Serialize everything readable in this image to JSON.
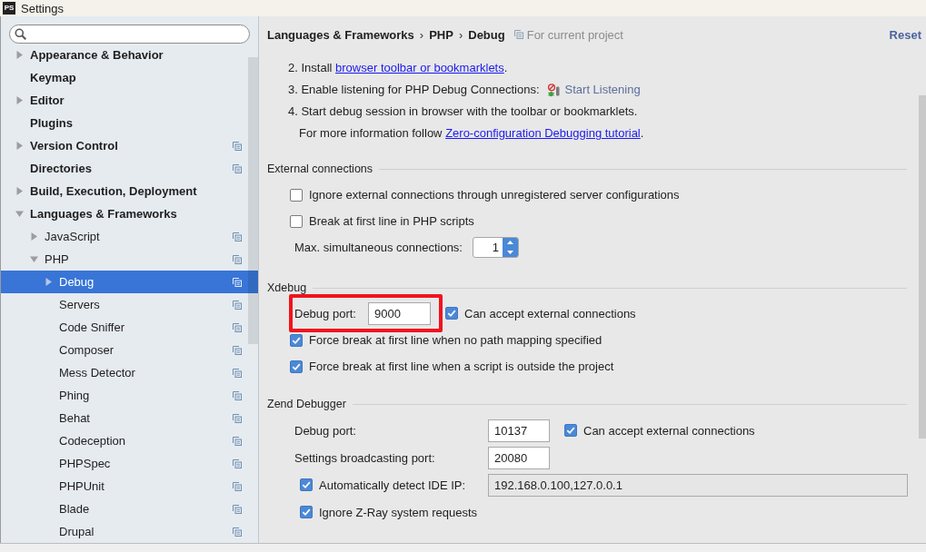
{
  "window": {
    "icon_text": "PS",
    "title": "Settings"
  },
  "sidebar": {
    "items": [
      {
        "label": "Appearance & Behavior",
        "expanded": false,
        "selected": false,
        "project_level": false
      },
      {
        "label": "Keymap",
        "selected": false,
        "project_level": false
      },
      {
        "label": "Editor",
        "expanded": false,
        "selected": false,
        "project_level": false
      },
      {
        "label": "Plugins",
        "selected": false,
        "project_level": false
      },
      {
        "label": "Version Control",
        "expanded": false,
        "selected": false,
        "project_level": true
      },
      {
        "label": "Directories",
        "selected": false,
        "project_level": true
      },
      {
        "label": "Build, Execution, Deployment",
        "expanded": false,
        "selected": false,
        "project_level": false
      },
      {
        "label": "Languages & Frameworks",
        "expanded": true,
        "selected": false,
        "project_level": false,
        "children": [
          {
            "label": "JavaScript",
            "expanded": false,
            "selected": false,
            "project_level": true
          },
          {
            "label": "PHP",
            "expanded": true,
            "selected": false,
            "project_level": true,
            "children": [
              {
                "label": "Debug",
                "expanded": false,
                "selected": true,
                "project_level": true
              },
              {
                "label": "Servers",
                "selected": false,
                "project_level": true
              },
              {
                "label": "Code Sniffer",
                "selected": false,
                "project_level": true
              },
              {
                "label": "Composer",
                "selected": false,
                "project_level": true
              },
              {
                "label": "Mess Detector",
                "selected": false,
                "project_level": true
              },
              {
                "label": "Phing",
                "selected": false,
                "project_level": true
              },
              {
                "label": "Behat",
                "selected": false,
                "project_level": true
              },
              {
                "label": "Codeception",
                "selected": false,
                "project_level": true
              },
              {
                "label": "PHPSpec",
                "selected": false,
                "project_level": true
              },
              {
                "label": "PHPUnit",
                "selected": false,
                "project_level": true
              },
              {
                "label": "Blade",
                "selected": false,
                "project_level": true
              },
              {
                "label": "Drupal",
                "selected": false,
                "project_level": true
              }
            ]
          }
        ]
      }
    ]
  },
  "header": {
    "breadcrumb": [
      {
        "kind": "crumb",
        "text": "Languages & Frameworks"
      },
      {
        "kind": "separator",
        "text": "›"
      },
      {
        "kind": "crumb",
        "text": "PHP"
      },
      {
        "kind": "separator",
        "text": "›"
      },
      {
        "kind": "crumb",
        "text": "Debug"
      }
    ],
    "scope": "For current project",
    "reset": "Reset"
  },
  "instructions": {
    "steps": [
      {
        "parts": [
          {
            "kind": "text",
            "text": "2. Install "
          },
          {
            "kind": "link",
            "text": "browser toolbar or bookmarklets"
          },
          {
            "kind": "text",
            "text": "."
          }
        ]
      },
      {
        "parts": [
          {
            "kind": "text",
            "text": "3. Enable listening for PHP Debug Connections:"
          },
          {
            "kind": "action",
            "text": "Start Listening"
          }
        ]
      },
      {
        "parts": [
          {
            "kind": "text",
            "text": "4. Start debug session in browser with the toolbar or bookmarklets."
          }
        ]
      }
    ],
    "note": {
      "parts": [
        {
          "kind": "text",
          "text": "For more information follow "
        },
        {
          "kind": "link",
          "text": "Zero-configuration Debugging tutorial"
        },
        {
          "kind": "text",
          "text": "."
        }
      ]
    }
  },
  "external_connections": {
    "title": "External connections",
    "options": [
      {
        "kind": "checkbox",
        "label": "Ignore external connections through unregistered server configurations",
        "checked": false
      },
      {
        "kind": "checkbox",
        "label": "Break at first line in PHP scripts",
        "checked": false
      },
      {
        "kind": "spinner",
        "label": "Max. simultaneous connections:",
        "value": "1"
      }
    ]
  },
  "xdebug": {
    "title": "Xdebug",
    "debug_port": {
      "label": "Debug port:",
      "value": "9000",
      "highlighted": true
    },
    "accept_external": {
      "label": "Can accept external connections",
      "checked": true
    },
    "options": [
      {
        "label": "Force break at first line when no path mapping specified",
        "checked": true
      },
      {
        "label": "Force break at first line when a script is outside the project",
        "checked": true
      }
    ]
  },
  "zend_debugger": {
    "title": "Zend Debugger",
    "debug_port": {
      "label": "Debug port:",
      "value": "10137"
    },
    "accept_external": {
      "label": "Can accept external connections",
      "checked": true
    },
    "broadcast_port": {
      "label": "Settings broadcasting port:",
      "value": "20080"
    },
    "detect_ip": {
      "label": "Automatically detect IDE IP:",
      "checked": true,
      "value": "192.168.0.100,127.0.0.1",
      "disabled": true
    },
    "ignore_zray": {
      "label": "Ignore Z-Ray system requests",
      "checked": true
    }
  }
}
